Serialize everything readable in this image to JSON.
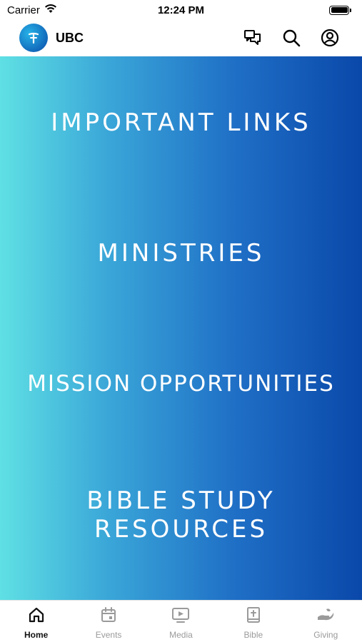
{
  "status_bar": {
    "carrier": "Carrier",
    "time": "12:24 PM"
  },
  "header": {
    "app_name": "UBC",
    "logo_glyph": "✝",
    "actions": [
      {
        "icon": "chat-icon"
      },
      {
        "icon": "search-icon"
      },
      {
        "icon": "account-icon"
      }
    ]
  },
  "hero": {
    "links": [
      {
        "label": "IMPORTANT LINKS"
      },
      {
        "label": "MINISTRIES"
      },
      {
        "label": "MISSION OPPORTUNITIES"
      },
      {
        "label_line1": "BIBLE STUDY",
        "label_line2": "RESOURCES"
      }
    ]
  },
  "tabs": [
    {
      "label": "Home",
      "icon": "home-icon",
      "active": true
    },
    {
      "label": "Events",
      "icon": "calendar-icon",
      "active": false
    },
    {
      "label": "Media",
      "icon": "media-icon",
      "active": false
    },
    {
      "label": "Bible",
      "icon": "bible-icon",
      "active": false
    },
    {
      "label": "Giving",
      "icon": "giving-icon",
      "active": false
    }
  ],
  "colors": {
    "gradient_start": "#5fe0e4",
    "gradient_end": "#0a48a9",
    "tab_active": "#111111",
    "tab_inactive": "#9a9a9a"
  }
}
